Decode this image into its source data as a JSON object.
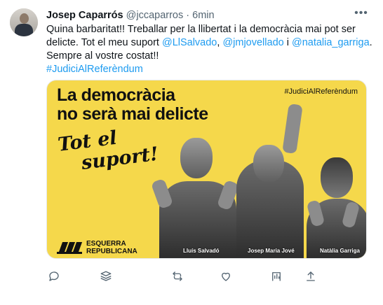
{
  "tweet": {
    "author_name": "Josep Caparrós",
    "author_handle": "@jccaparros",
    "separator": "·",
    "time": "6min",
    "text_part1": "Quina barbaritat!! Treballar per la llibertat i la democràcia mai pot ser delicte. Tot el meu suport ",
    "mention1": "@LlSalvado",
    "sep1": ", ",
    "mention2": "@jmjovellado",
    "sep2": " i ",
    "mention3": "@natalia_garriga",
    "text_part2": ". Sempre al vostre costat!!",
    "hashtag": "#JudiciAlReferèndum"
  },
  "media": {
    "headline_line1": "La democràcia",
    "headline_line2": "no serà mai delicte",
    "hashtag": "#JudiciAlReferèndum",
    "support_line1": "Tot el",
    "support_line2": "suport!",
    "party_line1": "ESQUERRA",
    "party_line2": "REPUBLICANA",
    "people": [
      "Lluís Salvadó",
      "Josep Maria Jové",
      "Natàlia Garriga"
    ],
    "background_color": "#f5d84b"
  },
  "actions": {
    "icons": [
      "reply-icon",
      "views-icon",
      "retweet-icon",
      "like-icon",
      "bookmark-icon",
      "share-icon"
    ]
  },
  "colors": {
    "link": "#1d9bf0",
    "secondary": "#536471",
    "text": "#0f1419"
  }
}
